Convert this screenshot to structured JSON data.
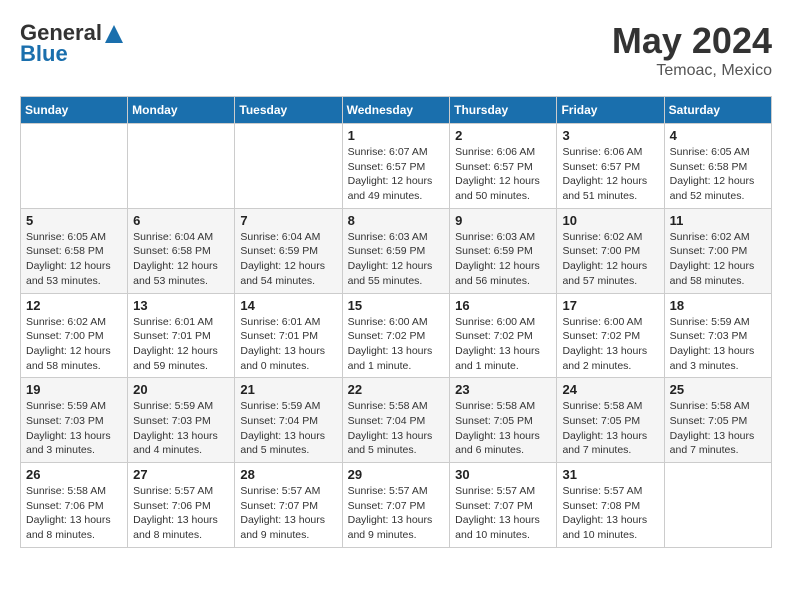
{
  "logo": {
    "line1": "General",
    "line2": "Blue",
    "tagline": ""
  },
  "header": {
    "month_year": "May 2024",
    "location": "Temoac, Mexico"
  },
  "days_of_week": [
    "Sunday",
    "Monday",
    "Tuesday",
    "Wednesday",
    "Thursday",
    "Friday",
    "Saturday"
  ],
  "weeks": [
    [
      {
        "day": "",
        "info": ""
      },
      {
        "day": "",
        "info": ""
      },
      {
        "day": "",
        "info": ""
      },
      {
        "day": "1",
        "info": "Sunrise: 6:07 AM\nSunset: 6:57 PM\nDaylight: 12 hours\nand 49 minutes."
      },
      {
        "day": "2",
        "info": "Sunrise: 6:06 AM\nSunset: 6:57 PM\nDaylight: 12 hours\nand 50 minutes."
      },
      {
        "day": "3",
        "info": "Sunrise: 6:06 AM\nSunset: 6:57 PM\nDaylight: 12 hours\nand 51 minutes."
      },
      {
        "day": "4",
        "info": "Sunrise: 6:05 AM\nSunset: 6:58 PM\nDaylight: 12 hours\nand 52 minutes."
      }
    ],
    [
      {
        "day": "5",
        "info": "Sunrise: 6:05 AM\nSunset: 6:58 PM\nDaylight: 12 hours\nand 53 minutes."
      },
      {
        "day": "6",
        "info": "Sunrise: 6:04 AM\nSunset: 6:58 PM\nDaylight: 12 hours\nand 53 minutes."
      },
      {
        "day": "7",
        "info": "Sunrise: 6:04 AM\nSunset: 6:59 PM\nDaylight: 12 hours\nand 54 minutes."
      },
      {
        "day": "8",
        "info": "Sunrise: 6:03 AM\nSunset: 6:59 PM\nDaylight: 12 hours\nand 55 minutes."
      },
      {
        "day": "9",
        "info": "Sunrise: 6:03 AM\nSunset: 6:59 PM\nDaylight: 12 hours\nand 56 minutes."
      },
      {
        "day": "10",
        "info": "Sunrise: 6:02 AM\nSunset: 7:00 PM\nDaylight: 12 hours\nand 57 minutes."
      },
      {
        "day": "11",
        "info": "Sunrise: 6:02 AM\nSunset: 7:00 PM\nDaylight: 12 hours\nand 58 minutes."
      }
    ],
    [
      {
        "day": "12",
        "info": "Sunrise: 6:02 AM\nSunset: 7:00 PM\nDaylight: 12 hours\nand 58 minutes."
      },
      {
        "day": "13",
        "info": "Sunrise: 6:01 AM\nSunset: 7:01 PM\nDaylight: 12 hours\nand 59 minutes."
      },
      {
        "day": "14",
        "info": "Sunrise: 6:01 AM\nSunset: 7:01 PM\nDaylight: 13 hours\nand 0 minutes."
      },
      {
        "day": "15",
        "info": "Sunrise: 6:00 AM\nSunset: 7:02 PM\nDaylight: 13 hours\nand 1 minute."
      },
      {
        "day": "16",
        "info": "Sunrise: 6:00 AM\nSunset: 7:02 PM\nDaylight: 13 hours\nand 1 minute."
      },
      {
        "day": "17",
        "info": "Sunrise: 6:00 AM\nSunset: 7:02 PM\nDaylight: 13 hours\nand 2 minutes."
      },
      {
        "day": "18",
        "info": "Sunrise: 5:59 AM\nSunset: 7:03 PM\nDaylight: 13 hours\nand 3 minutes."
      }
    ],
    [
      {
        "day": "19",
        "info": "Sunrise: 5:59 AM\nSunset: 7:03 PM\nDaylight: 13 hours\nand 3 minutes."
      },
      {
        "day": "20",
        "info": "Sunrise: 5:59 AM\nSunset: 7:03 PM\nDaylight: 13 hours\nand 4 minutes."
      },
      {
        "day": "21",
        "info": "Sunrise: 5:59 AM\nSunset: 7:04 PM\nDaylight: 13 hours\nand 5 minutes."
      },
      {
        "day": "22",
        "info": "Sunrise: 5:58 AM\nSunset: 7:04 PM\nDaylight: 13 hours\nand 5 minutes."
      },
      {
        "day": "23",
        "info": "Sunrise: 5:58 AM\nSunset: 7:05 PM\nDaylight: 13 hours\nand 6 minutes."
      },
      {
        "day": "24",
        "info": "Sunrise: 5:58 AM\nSunset: 7:05 PM\nDaylight: 13 hours\nand 7 minutes."
      },
      {
        "day": "25",
        "info": "Sunrise: 5:58 AM\nSunset: 7:05 PM\nDaylight: 13 hours\nand 7 minutes."
      }
    ],
    [
      {
        "day": "26",
        "info": "Sunrise: 5:58 AM\nSunset: 7:06 PM\nDaylight: 13 hours\nand 8 minutes."
      },
      {
        "day": "27",
        "info": "Sunrise: 5:57 AM\nSunset: 7:06 PM\nDaylight: 13 hours\nand 8 minutes."
      },
      {
        "day": "28",
        "info": "Sunrise: 5:57 AM\nSunset: 7:07 PM\nDaylight: 13 hours\nand 9 minutes."
      },
      {
        "day": "29",
        "info": "Sunrise: 5:57 AM\nSunset: 7:07 PM\nDaylight: 13 hours\nand 9 minutes."
      },
      {
        "day": "30",
        "info": "Sunrise: 5:57 AM\nSunset: 7:07 PM\nDaylight: 13 hours\nand 10 minutes."
      },
      {
        "day": "31",
        "info": "Sunrise: 5:57 AM\nSunset: 7:08 PM\nDaylight: 13 hours\nand 10 minutes."
      },
      {
        "day": "",
        "info": ""
      }
    ]
  ]
}
